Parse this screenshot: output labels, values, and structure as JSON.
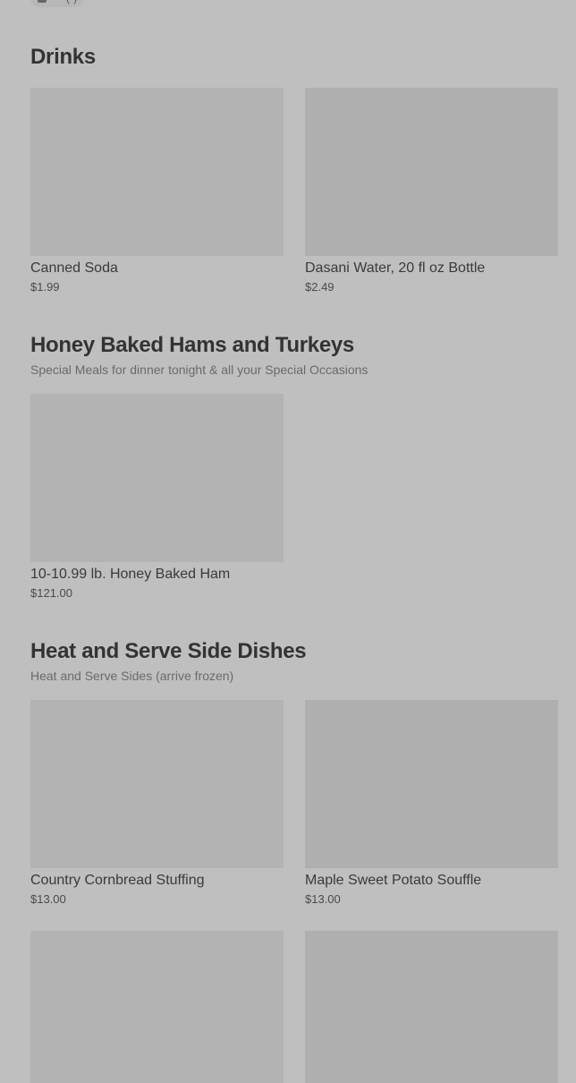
{
  "top_chip": {
    "label": "••• (•)"
  },
  "sections": [
    {
      "title": "Drinks",
      "subtitle": "",
      "items": [
        {
          "name": "Canned Soda",
          "price": "$1.99"
        },
        {
          "name": "Dasani Water, 20 fl oz Bottle",
          "price": "$2.49"
        }
      ]
    },
    {
      "title": "Honey Baked Hams and Turkeys",
      "subtitle": "Special Meals for dinner tonight & all your Special Occasions",
      "items": [
        {
          "name": "10-10.99 lb. Honey Baked Ham",
          "price": "$121.00"
        }
      ]
    },
    {
      "title": "Heat and Serve Side Dishes",
      "subtitle": "Heat and Serve Sides (arrive frozen)",
      "items": [
        {
          "name": "Country Cornbread Stuffing",
          "price": "$13.00"
        },
        {
          "name": "Maple Sweet Potato Souffle",
          "price": "$13.00"
        }
      ]
    }
  ],
  "colors": {
    "background": "#bfbfbf",
    "image_placeholder": "#b3b3b3",
    "title_text": "#333333",
    "subtitle_text": "#6a6a6a"
  }
}
